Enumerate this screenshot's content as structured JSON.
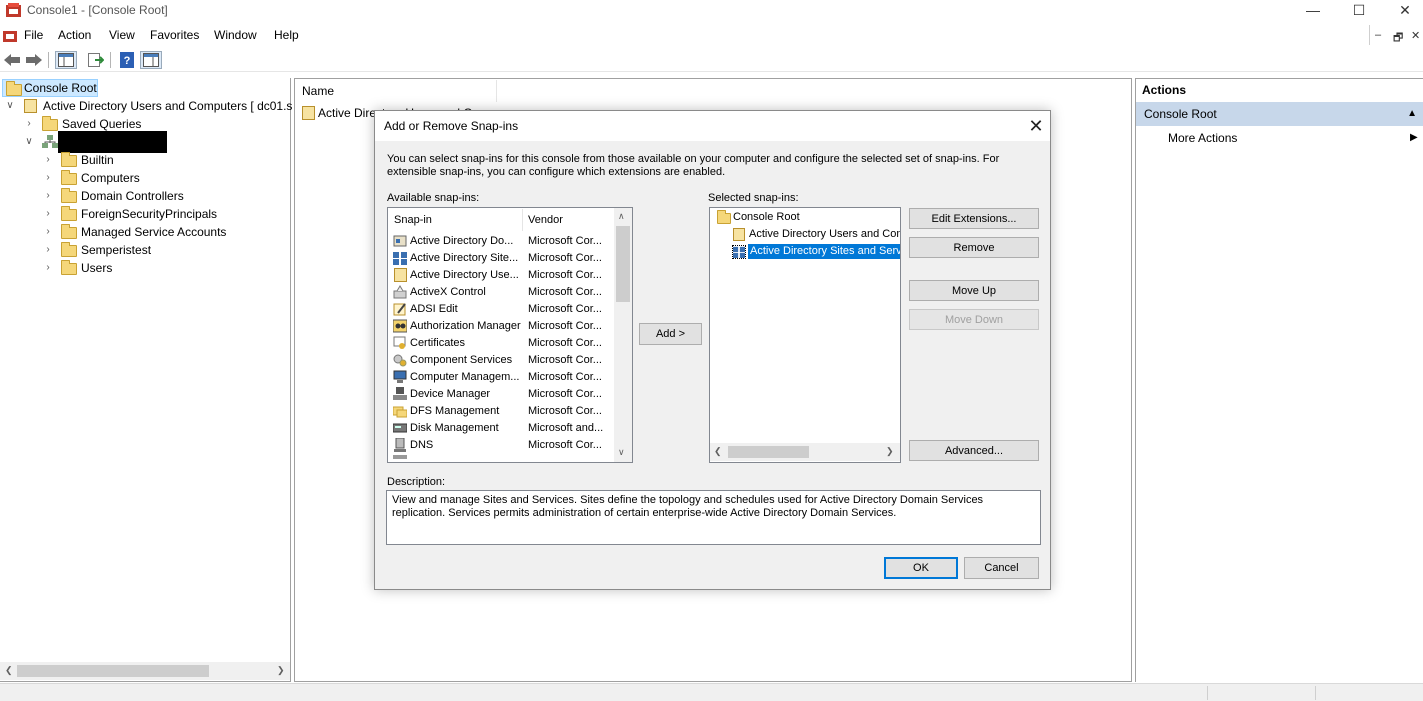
{
  "window": {
    "title": "Console1 - [Console Root]",
    "controls": {
      "minimize": "—",
      "maximize": "☐",
      "close": "✕"
    }
  },
  "menu": {
    "items": [
      "File",
      "Action",
      "View",
      "Favorites",
      "Window",
      "Help"
    ],
    "mdi_controls": {
      "minimize": "–",
      "restore": "🗗",
      "close": "✕"
    }
  },
  "tree": {
    "root": "Console Root",
    "aduc": "Active Directory Users and Computers [ dc01.s",
    "saved_queries": "Saved Queries",
    "domain_children": [
      "Builtin",
      "Computers",
      "Domain Controllers",
      "ForeignSecurityPrincipals",
      "Managed Service Accounts",
      "Semperistest",
      "Users"
    ]
  },
  "center": {
    "column_name": "Name",
    "item": "Active Directory Users and C"
  },
  "actions": {
    "header": "Actions",
    "section": "Console Root",
    "more": "More Actions"
  },
  "dialog": {
    "title": "Add or Remove Snap-ins",
    "intro": "You can select snap-ins for this console from those available on your computer and configure the selected set of snap-ins. For extensible snap-ins, you can configure which extensions are enabled.",
    "available_label": "Available snap-ins:",
    "selected_label": "Selected snap-ins:",
    "columns": {
      "snapin": "Snap-in",
      "vendor": "Vendor"
    },
    "available": [
      {
        "name": "Active Directory Do...",
        "vendor": "Microsoft Cor..."
      },
      {
        "name": "Active Directory Site...",
        "vendor": "Microsoft Cor..."
      },
      {
        "name": "Active Directory Use...",
        "vendor": "Microsoft Cor..."
      },
      {
        "name": "ActiveX Control",
        "vendor": "Microsoft Cor..."
      },
      {
        "name": "ADSI Edit",
        "vendor": "Microsoft Cor..."
      },
      {
        "name": "Authorization Manager",
        "vendor": "Microsoft Cor..."
      },
      {
        "name": "Certificates",
        "vendor": "Microsoft Cor..."
      },
      {
        "name": "Component Services",
        "vendor": "Microsoft Cor..."
      },
      {
        "name": "Computer Managem...",
        "vendor": "Microsoft Cor..."
      },
      {
        "name": "Device Manager",
        "vendor": "Microsoft Cor..."
      },
      {
        "name": "DFS Management",
        "vendor": "Microsoft Cor..."
      },
      {
        "name": "Disk Management",
        "vendor": "Microsoft and..."
      },
      {
        "name": "DNS",
        "vendor": "Microsoft Cor..."
      }
    ],
    "selected": {
      "root": "Console Root",
      "items": [
        "Active Directory Users and Com",
        "Active Directory Sites and Serv"
      ]
    },
    "buttons": {
      "add": "Add >",
      "edit_extensions": "Edit Extensions...",
      "remove": "Remove",
      "move_up": "Move Up",
      "move_down": "Move Down",
      "advanced": "Advanced...",
      "ok": "OK",
      "cancel": "Cancel"
    },
    "description_label": "Description:",
    "description": "View and manage Sites and Services. Sites define the topology and schedules used for Active Directory Domain Services replication. Services permits administration of certain enterprise-wide Active Directory Domain Services."
  },
  "colors": {
    "selection": "#0078d7",
    "actions_section": "#c7d7ea",
    "folder": "#f5d77a"
  }
}
